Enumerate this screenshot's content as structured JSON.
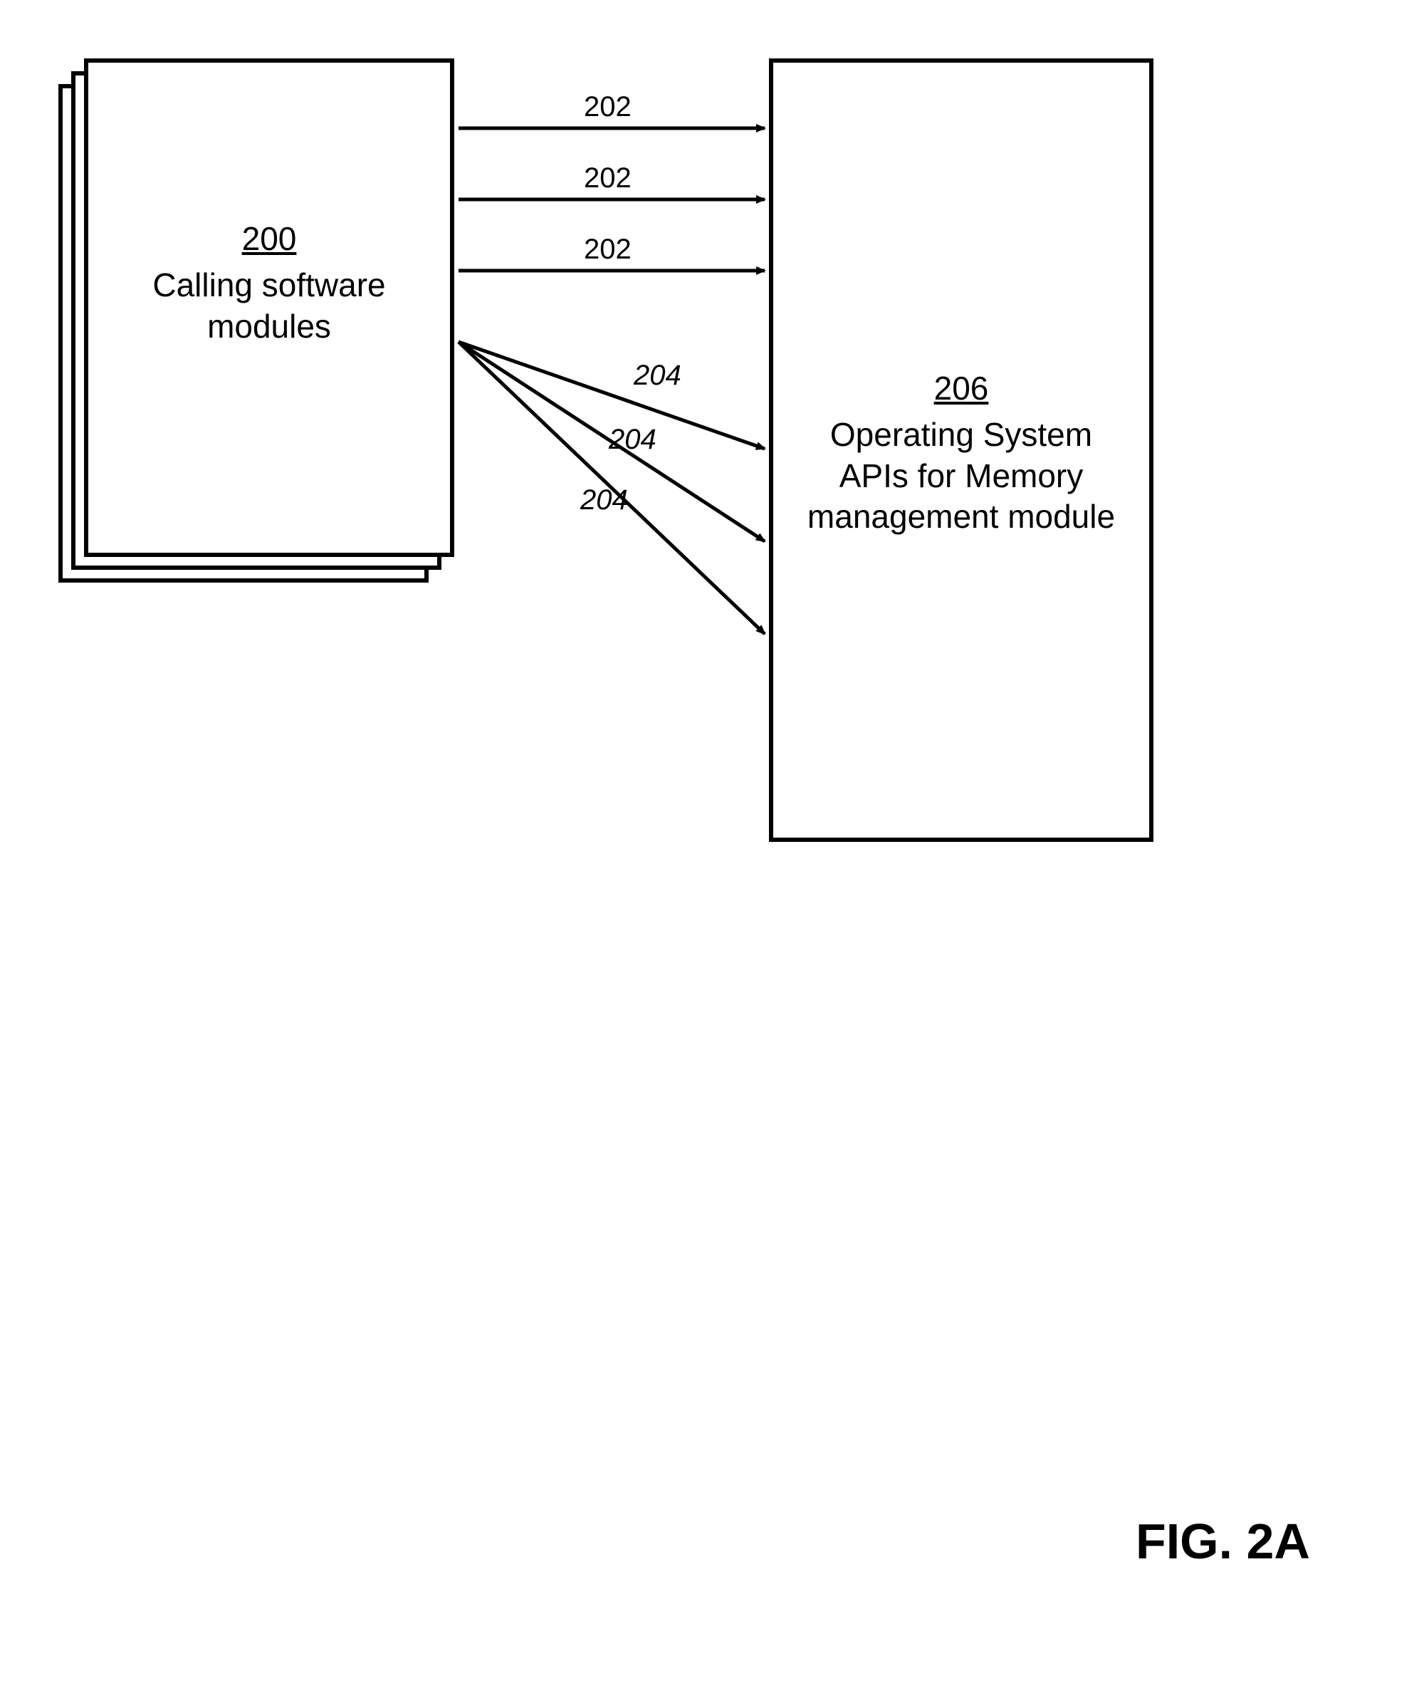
{
  "figure_label": "FIG. 2A",
  "left_box": {
    "ref": "200",
    "label_line1": "Calling software",
    "label_line2": "modules"
  },
  "right_box": {
    "ref": "206",
    "label_line1": "Operating System",
    "label_line2": "APIs for Memory",
    "label_line3": "management module"
  },
  "arrows": {
    "top1": "202",
    "top2": "202",
    "top3": "202",
    "bot1": "204",
    "bot2": "204",
    "bot3": "204"
  }
}
